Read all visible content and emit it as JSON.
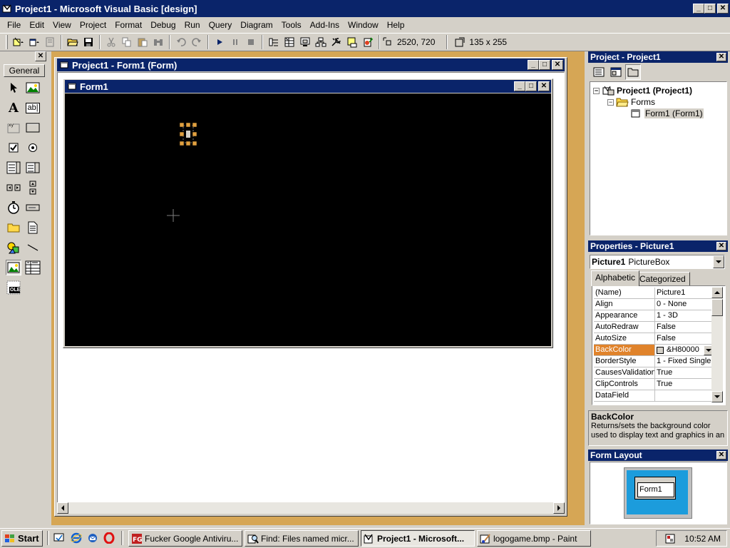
{
  "app": {
    "title": "Project1 - Microsoft Visual Basic [design]",
    "caption_buttons": {
      "minimize": "_",
      "maximize": "□",
      "close": "✕"
    }
  },
  "menu": [
    "File",
    "Edit",
    "View",
    "Project",
    "Format",
    "Debug",
    "Run",
    "Query",
    "Diagram",
    "Tools",
    "Add-Ins",
    "Window",
    "Help"
  ],
  "toolbar": {
    "position": "2520, 720",
    "size": "135 x 255"
  },
  "toolbox": {
    "tab_label": "General",
    "close": "✕",
    "tools": [
      "pointer-icon",
      "picturebox-icon",
      "label-icon",
      "textbox-icon",
      "frame-icon",
      "commandbutton-icon",
      "checkbox-icon",
      "optionbutton-icon",
      "combobox-icon",
      "listbox-icon",
      "hscrollbar-icon",
      "vscrollbar-icon",
      "timer-icon",
      "drivelistbox-icon",
      "dirlistbox-icon",
      "filelistbox-icon",
      "shape-icon",
      "line-icon",
      "image-icon",
      "data-icon",
      "ole-icon"
    ],
    "ole_label": "OLE",
    "label_glyph": "A",
    "textbox_glyph": "ab|"
  },
  "designer": {
    "window_title": "Project1 - Form1 (Form)",
    "form_title": "Form1",
    "form_backcolor": "#000000"
  },
  "project_explorer": {
    "title": "Project - Project1",
    "close": "✕",
    "tree": {
      "root": "Project1 (Project1)",
      "folder": "Forms",
      "item": "Form1 (Form1)",
      "expander": "−"
    }
  },
  "properties": {
    "title": "Properties - Picture1",
    "close": "✕",
    "object_name": "Picture1",
    "object_type": "PictureBox",
    "tabs": [
      "Alphabetic",
      "Categorized"
    ],
    "rows": [
      {
        "name": "(Name)",
        "value": "Picture1"
      },
      {
        "name": "Align",
        "value": "0 - None"
      },
      {
        "name": "Appearance",
        "value": "1 - 3D"
      },
      {
        "name": "AutoRedraw",
        "value": "False"
      },
      {
        "name": "AutoSize",
        "value": "False"
      },
      {
        "name": "BackColor",
        "value": "&H80000",
        "selected": true
      },
      {
        "name": "BorderStyle",
        "value": "1 - Fixed Single"
      },
      {
        "name": "CausesValidation",
        "value": "True"
      },
      {
        "name": "ClipControls",
        "value": "True"
      },
      {
        "name": "DataField",
        "value": ""
      }
    ],
    "description": {
      "title": "BackColor",
      "text": "Returns/sets the background color used to display text and graphics in an"
    }
  },
  "form_layout": {
    "title": "Form Layout",
    "close": "✕",
    "form_label": "Form1"
  },
  "taskbar": {
    "start_label": "Start",
    "tasks": [
      {
        "label": "Fucker Google Antiviru...",
        "icon": "fg-icon",
        "active": false
      },
      {
        "label": "Find: Files named micr...",
        "icon": "search-icon",
        "active": false
      },
      {
        "label": "Project1 - Microsoft...",
        "icon": "vb-icon",
        "active": true
      },
      {
        "label": "logogame.bmp - Paint",
        "icon": "paint-icon",
        "active": false
      }
    ],
    "clock": "10:52 AM"
  },
  "colors": {
    "title_active": "#0a246a",
    "mdi_background": "#d6a655",
    "selected_property": "#e0832b",
    "monitor_screen": "#1c9cdc"
  }
}
